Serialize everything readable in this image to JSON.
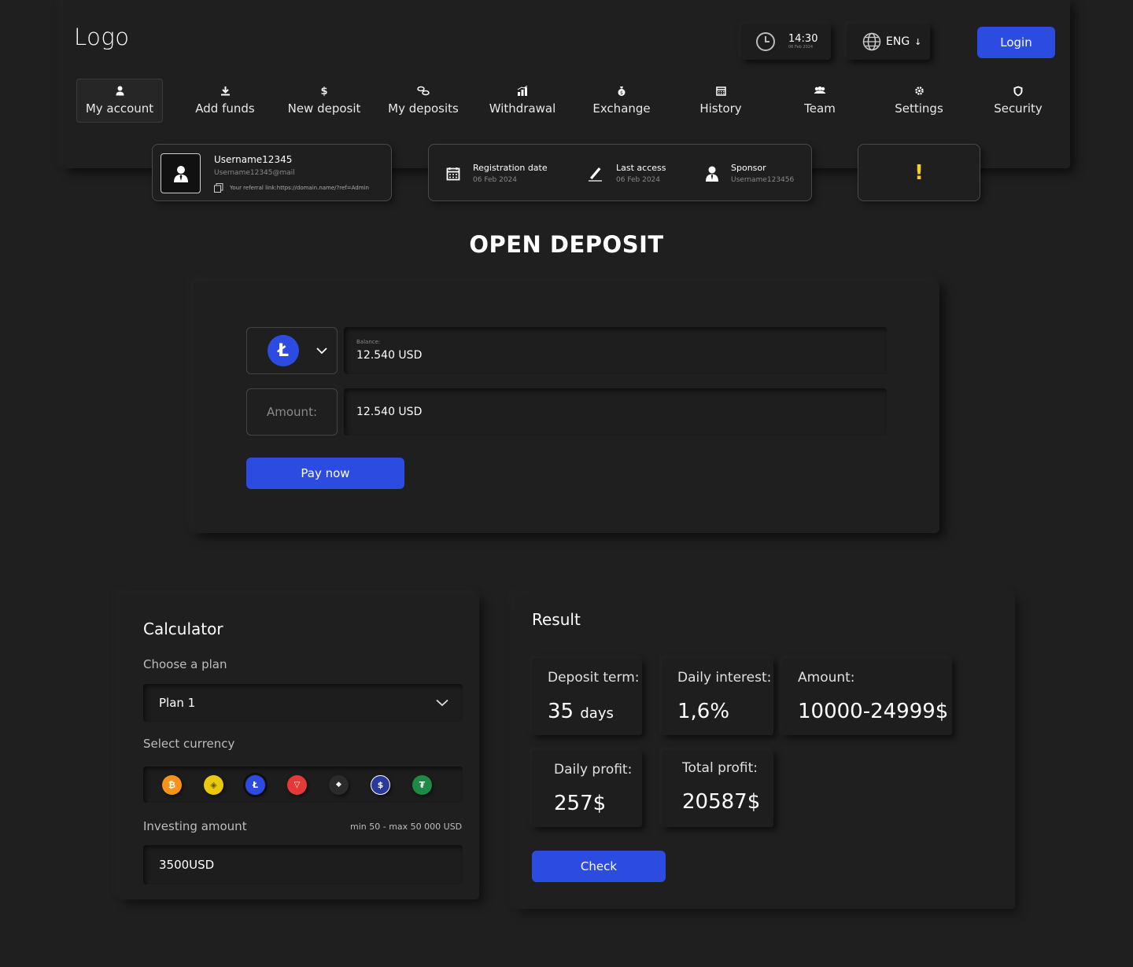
{
  "header": {
    "logo": "Logo",
    "time": "14:30",
    "date": "06 Feb 2024",
    "language": "ENG",
    "login_label": "Login"
  },
  "nav": [
    {
      "label": "My account",
      "icon": "user-icon"
    },
    {
      "label": "Add funds",
      "icon": "download-icon"
    },
    {
      "label": "New deposit",
      "icon": "dollar-icon"
    },
    {
      "label": "My deposits",
      "icon": "coins-icon"
    },
    {
      "label": "Withdrawal",
      "icon": "chart-icon"
    },
    {
      "label": "Exchange",
      "icon": "moneybag-icon"
    },
    {
      "label": "History",
      "icon": "calendar-icon"
    },
    {
      "label": "Team",
      "icon": "team-icon"
    },
    {
      "label": "Settings",
      "icon": "gear-icon"
    },
    {
      "label": "Security",
      "icon": "shield-icon"
    }
  ],
  "user": {
    "username": "Username12345",
    "email": "Username12345@mail",
    "referral": "Your referral link:https://domain.name/?ref=Admin"
  },
  "info": {
    "registration_label": "Registration date",
    "registration_value": "06 Feb 2024",
    "last_access_label": "Last access",
    "last_access_value": "06 Feb 2024",
    "sponsor_label": "Sponsor",
    "sponsor_value": "Username123456"
  },
  "warning": "!",
  "deposit": {
    "title": "OPEN DEPOSIT",
    "balance_label": "Balance:",
    "balance_value": "12.540 USD",
    "amount_label": "Amount:",
    "amount_value": "12.540 USD",
    "pay_label": "Pay now"
  },
  "calculator": {
    "title": "Calculator",
    "plan_label": "Choose a plan",
    "plan_value": "Plan 1",
    "currency_label": "Select currency",
    "currencies": [
      {
        "name": "bitcoin",
        "symbol": "₿",
        "color": "#f7931a"
      },
      {
        "name": "bnb",
        "symbol": "◈",
        "color": "#e8c90f"
      },
      {
        "name": "litecoin",
        "symbol": "Ł",
        "color": "#2c4be0"
      },
      {
        "name": "tron",
        "symbol": "▽",
        "color": "#e53935"
      },
      {
        "name": "ethereum",
        "symbol": "◆",
        "color": "#2b2b2b"
      },
      {
        "name": "usdc",
        "symbol": "$",
        "color": "#2a3a9a"
      },
      {
        "name": "tether",
        "symbol": "₮",
        "color": "#1f8a46"
      }
    ],
    "invest_label": "Investing amount",
    "invest_hint": "min 50 - max 50 000 USD",
    "invest_value": "3500USD"
  },
  "result": {
    "title": "Result",
    "term_label": "Deposit term:",
    "term_value": "35",
    "term_unit": "days",
    "interest_label": "Daily interest:",
    "interest_value": "1,6%",
    "amount_label": "Amount:",
    "amount_value": "10000-24999$",
    "daily_label": "Daily profit:",
    "daily_value": "257$",
    "total_label": "Total profit:",
    "total_value": "20587$",
    "check_label": "Check"
  }
}
